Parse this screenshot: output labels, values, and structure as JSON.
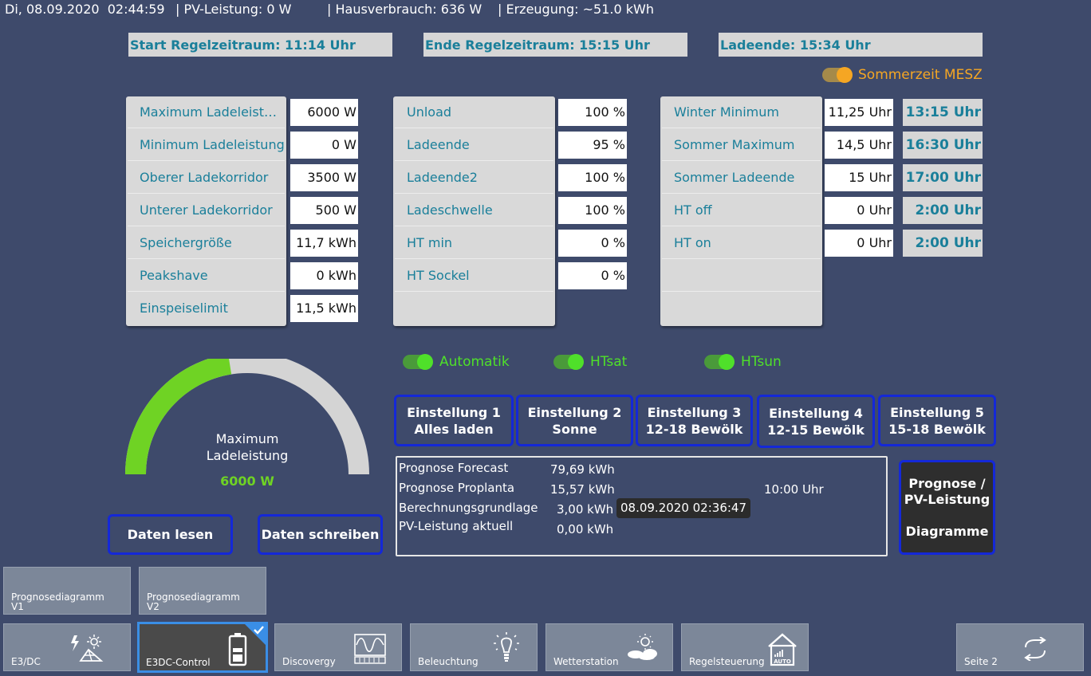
{
  "status_bar": {
    "datetime": "Di, 08.09.2020  02:44:59",
    "pv": "| PV-Leistung: 0 W",
    "haus": "| Hausverbrauch: 636 W",
    "erzeugung": "| Erzeugung: ~51.0 kWh"
  },
  "times": {
    "start": "Start Regelzeitraum: 11:14 Uhr",
    "ende": "Ende Regelzeitraum: 15:15 Uhr",
    "ladeende": "Ladeende: 15:34 Uhr"
  },
  "sommerzeit": {
    "label": "Sommerzeit MESZ",
    "on": true,
    "color": "#f5a623"
  },
  "panel1": [
    {
      "label": "Maximum Ladeleistung",
      "value": "6000 W"
    },
    {
      "label": "Minimum Ladeleistung",
      "value": "0 W"
    },
    {
      "label": "Oberer Ladekorridor",
      "value": "3500 W"
    },
    {
      "label": "Unterer Ladekorridor",
      "value": "500 W"
    },
    {
      "label": "Speichergröße",
      "value": "11,7 kWh"
    },
    {
      "label": "Peakshave",
      "value": "0 kWh"
    },
    {
      "label": "Einspeiselimit",
      "value": "11,5 kWh"
    }
  ],
  "panel2": [
    {
      "label": "Unload",
      "value": "100 %"
    },
    {
      "label": "Ladeende",
      "value": "95 %"
    },
    {
      "label": "Ladeende2",
      "value": "100 %"
    },
    {
      "label": "Ladeschwelle",
      "value": "100 %"
    },
    {
      "label": "HT min",
      "value": "0 %"
    },
    {
      "label": "HT Sockel",
      "value": "0 %"
    }
  ],
  "panel3": [
    {
      "label": "Winter Minimum",
      "value": "11,25 Uhr",
      "result": "13:15 Uhr"
    },
    {
      "label": "Sommer Maximum",
      "value": "14,5 Uhr",
      "result": "16:30 Uhr"
    },
    {
      "label": "Sommer Ladeende",
      "value": "15 Uhr",
      "result": "17:00 Uhr"
    },
    {
      "label": "HT off",
      "value": "0 Uhr",
      "result": "2:00 Uhr"
    },
    {
      "label": "HT on",
      "value": "0 Uhr",
      "result": "2:00 Uhr"
    }
  ],
  "toggles": [
    {
      "label": "Automatik",
      "on": true
    },
    {
      "label": "HTsat",
      "on": true
    },
    {
      "label": "HTsun",
      "on": true
    }
  ],
  "gauge": {
    "label_line1": "Maximum",
    "label_line2": "Ladeleistung",
    "value_text": "6000 W",
    "fraction": 0.45,
    "fill_color": "#6fd324",
    "track_color": "#d4d4d4"
  },
  "buttons": {
    "daten_lesen": "Daten lesen",
    "daten_schreiben": "Daten schreiben",
    "einstellungen": [
      {
        "line1": "Einstellung 1",
        "line2": "Alles laden"
      },
      {
        "line1": "Einstellung 2",
        "line2": "Sonne"
      },
      {
        "line1": "Einstellung 3",
        "line2": "12-18 Bewölk"
      },
      {
        "line1": "Einstellung 4",
        "line2": "12-15 Bewölk"
      },
      {
        "line1": "Einstellung 5",
        "line2": "15-18 Bewölk"
      }
    ],
    "prognose": {
      "line1": "Prognose /",
      "line2": "PV-Leistung",
      "line3": "Diagramme"
    }
  },
  "info": {
    "rows": [
      {
        "label": "Prognose Forecast",
        "value": "79,69 kWh"
      },
      {
        "label": "Prognose Proplanta",
        "value": "15,57 kWh"
      },
      {
        "label": "Berechnungsgrundlage",
        "value": "3,00 kWh"
      },
      {
        "label": "PV-Leistung aktuell",
        "value": "0,00 kWh"
      }
    ],
    "time": "10:00 Uhr",
    "timestamp": "08.09.2020 02:36:47"
  },
  "nav_top": [
    {
      "line1": "Prognosediagramm",
      "line2": "V1"
    },
    {
      "line1": "Prognosediagramm",
      "line2": "V2"
    }
  ],
  "nav_bottom": [
    {
      "label": "E3/DC",
      "icon": "solar-panel-icon"
    },
    {
      "label": "E3DC-Control",
      "icon": "battery-icon",
      "active": true
    },
    {
      "label": "Discovergy",
      "icon": "meter-icon"
    },
    {
      "label": "Beleuchtung",
      "icon": "lightbulb-icon"
    },
    {
      "label": "Wetterstation",
      "icon": "weather-icon"
    },
    {
      "label": "Regelsteuerung",
      "icon": "house-auto-icon"
    }
  ],
  "page_button": {
    "label": "Seite 2",
    "icon": "swap-arrows-icon"
  }
}
